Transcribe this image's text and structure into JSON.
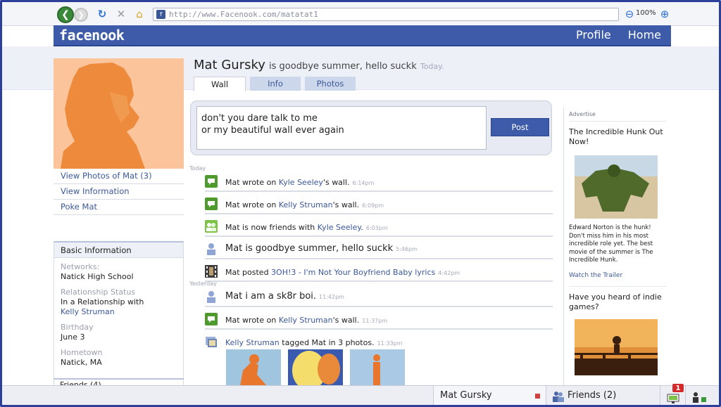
{
  "browser": {
    "url": "http://www.Facenook.com/matatat1",
    "zoom": "100%"
  },
  "header": {
    "logo": "facenook",
    "nav": [
      "Profile",
      "Home"
    ]
  },
  "profile": {
    "name": "Mat Gursky",
    "status": "is goodbye summer, hello suckk",
    "status_time": "Today.",
    "tabs": [
      "Wall",
      "Info",
      "Photos"
    ],
    "active_tab": "Wall"
  },
  "sidebar": {
    "links": [
      "View Photos of Mat (3)",
      "View Information",
      "Poke Mat"
    ],
    "basic_info": {
      "title": "Basic Information",
      "networks_label": "Networks:",
      "networks_value": "Natick High School",
      "relationship_label": "Relationship Status",
      "relationship_value": "In a Relationship with",
      "relationship_link": "Kelly Struman",
      "birthday_label": "Birthday",
      "birthday_value": "June 3",
      "hometown_label": "Hometown",
      "hometown_value": "Natick, MA"
    },
    "friends_heading": "Friends (4)"
  },
  "composer": {
    "text": "don't you dare talk to me\nor my beautiful wall ever again",
    "post_label": "Post"
  },
  "feed": {
    "sections": [
      "Today",
      "Yesterday"
    ],
    "items": [
      {
        "pre": "Mat wrote on ",
        "link": "Kyle Seeley",
        "post": "'s wall.",
        "time": "6:14pm"
      },
      {
        "pre": "Mat wrote on ",
        "link": "Kelly Struman",
        "post": "'s wall.",
        "time": "6:09pm"
      },
      {
        "pre": "Mat is now friends with ",
        "link": "Kyle Seeley",
        "post": ".",
        "time": "6:03pm"
      },
      {
        "pre": "Mat is goodbye summer, hello suckk",
        "link": "",
        "post": "",
        "time": "5:46pm"
      },
      {
        "pre": "Mat posted ",
        "link": "3OH!3 - I'm Not Your Boyfriend Baby lyrics",
        "post": "",
        "time": "4:42pm"
      },
      {
        "pre": "Mat i am a sk8r boi.",
        "link": "",
        "post": "",
        "time": "11:42pm"
      },
      {
        "pre": "Mat wrote on ",
        "link": "Kelly Struman",
        "post": "'s wall.",
        "time": "11:37pm"
      },
      {
        "pre": "",
        "link": "Kelly Struman",
        "post": " tagged Mat in 3 photos.",
        "time": "11:33pm"
      }
    ]
  },
  "ads": {
    "heading": "Advertise",
    "ad1_title": "The Incredible Hunk Out Now!",
    "ad1_body": "Edward Norton is the hunk! Don't miss him in his most incredible role yet. The best movie of the summer is The Incredible Hunk.",
    "ad1_link": "Watch the Trailer",
    "ad2_title": "Have you heard of indie games?"
  },
  "chatbar": {
    "user": "Mat Gursky",
    "friends": "Friends (2)",
    "notifications": "1"
  }
}
